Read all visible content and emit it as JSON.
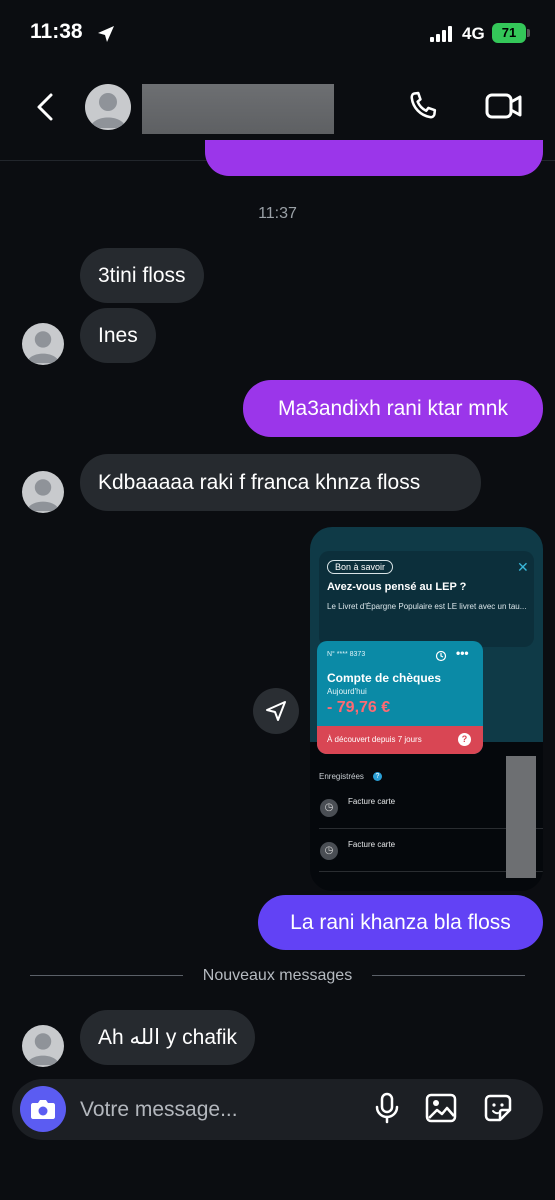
{
  "status_bar": {
    "time": "11:38",
    "network": "4G",
    "battery": "71"
  },
  "header": {
    "back_icon": "chevron-left-icon",
    "call_icon": "phone-icon",
    "video_icon": "video-camera-icon"
  },
  "chat": {
    "timestamp": "11:37",
    "messages": [
      {
        "text": "3tini floss",
        "dir": "in"
      },
      {
        "text": "Ines",
        "dir": "in"
      },
      {
        "text": "Ma3andixh rani ktar mnk",
        "dir": "out"
      },
      {
        "text": "Kdbaaaaa raki f franca khnza floss",
        "dir": "in"
      },
      {
        "text": "La rani khanza bla floss",
        "dir": "out"
      },
      {
        "text": "Ah الله y chafik",
        "dir": "in"
      }
    ],
    "new_messages_label": "Nouveaux messages"
  },
  "shared_screenshot": {
    "promo": {
      "tag": "Bon à savoir",
      "title": "Avez-vous pensé au LEP ?",
      "text": "Le Livret d'Épargne Populaire est LE livret avec un tau..."
    },
    "account": {
      "number": "N° **** 8373",
      "title": "Compte de chèques",
      "subtitle": "Aujourd'hui",
      "balance": "- 79,76 €",
      "warning": "À découvert depuis 7 jours"
    },
    "section_label": "Enregistrées",
    "transactions": [
      {
        "label": "Facture carte"
      },
      {
        "label": "Facture carte"
      }
    ]
  },
  "composer": {
    "placeholder": "Votre message..."
  },
  "colors": {
    "outgoing": "#9b36ea",
    "outgoing_alt": "#6242f5",
    "incoming": "#262a2f",
    "background": "#0b0d11",
    "camera": "#5b5cf2"
  }
}
